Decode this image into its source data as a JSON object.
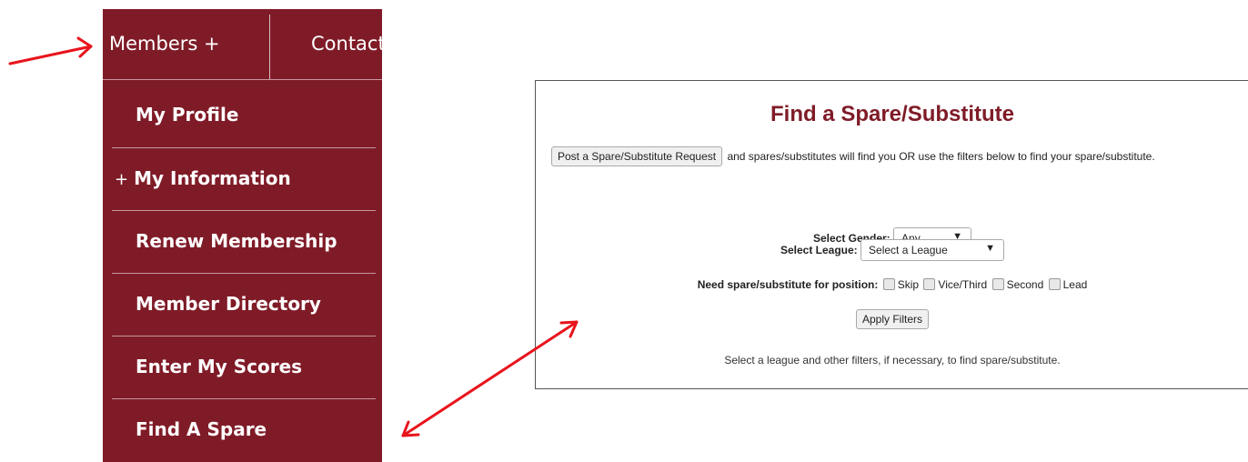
{
  "menu": {
    "top_items": [
      {
        "label": "Members +"
      },
      {
        "label": "Contact"
      }
    ],
    "sub_items": [
      {
        "label": "My Profile"
      },
      {
        "prefix": "+",
        "label": "My Information"
      },
      {
        "label": "Renew Membership"
      },
      {
        "label": "Member Directory"
      },
      {
        "label": "Enter My Scores"
      },
      {
        "label": "Find A Spare"
      }
    ]
  },
  "panel": {
    "title": "Find a Spare/Substitute",
    "post_button": "Post a Spare/Substitute Request",
    "post_text": "and spares/substitutes will find you OR use the filters below to find your spare/substitute.",
    "gender": {
      "label": "Select Gender:",
      "value": "Any"
    },
    "league": {
      "label": "Select League:",
      "value": "Select a League"
    },
    "position": {
      "label": "Need spare/substitute for position:",
      "options": [
        "Skip",
        "Vice/Third",
        "Second",
        "Lead"
      ]
    },
    "apply_button": "Apply Filters",
    "result_text": "Select a league and other filters, if necessary, to find spare/substitute."
  },
  "colors": {
    "accent": "#7f1b27",
    "annotation": "#e8141c"
  }
}
